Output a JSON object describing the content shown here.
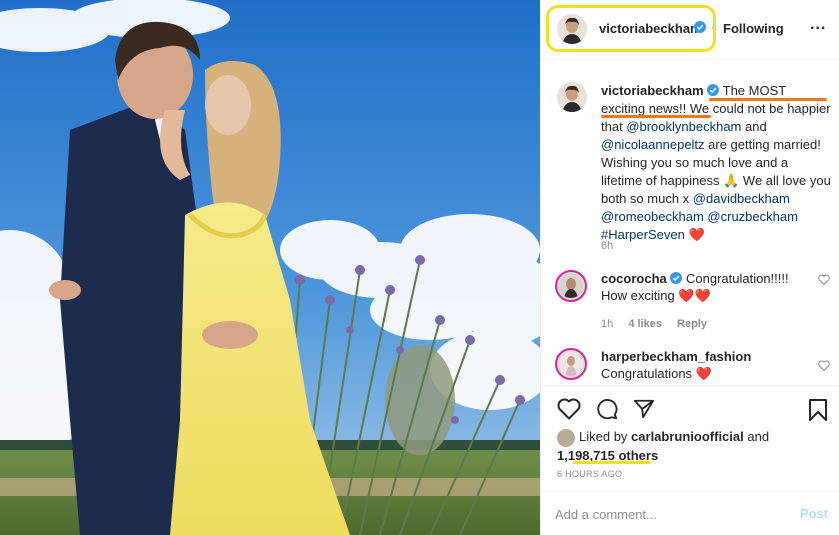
{
  "post": {
    "author": "victoriabeckham",
    "follow_separator": "•",
    "follow_status": "Following",
    "more_label": "...",
    "caption": {
      "author": "victoriabeckham",
      "part1": "The MOST exciting news!! We could not be happier that ",
      "mention1": "@brooklynbeckham",
      "part2": " and ",
      "mention2": "@nicolaannepeltz",
      "part3": " are getting married! Wishing you so much love and a lifetime of happiness 🙏 We all love you both so much x ",
      "mention3": "@davidbeckham",
      "mention4": "@romeobeckham",
      "mention5": "@cruzbeckham",
      "hashtag": "#HarperSeven",
      "emoji_end": "❤️",
      "time": "6h"
    },
    "comments": [
      {
        "user": "cocorocha",
        "text": "Congratulation!!!!! How exciting",
        "emoji": "❤️❤️",
        "time": "1h",
        "likes": "4 likes",
        "reply": "Reply"
      },
      {
        "user": "harperbeckham_fashion",
        "text": "Congratulations",
        "emoji": "❤️"
      }
    ],
    "likes": {
      "prefix": "Liked by",
      "user": "carlabrunio fficial",
      "user_display": "carlabrunioofficial",
      "and": "and",
      "count": "1,198,715 others"
    },
    "timestamp": "6 HOURS AGO",
    "add_comment_placeholder": "Add a comment...",
    "post_button": "Post"
  },
  "icons": {
    "verified": "verified-badge-icon",
    "heart": "heart-icon",
    "comment": "comment-icon",
    "share": "share-icon",
    "bookmark": "bookmark-icon"
  },
  "colors": {
    "verified_blue": "#3897f0",
    "link_blue": "#00376b",
    "annotation_yellow": "#f4e01c",
    "annotation_orange": "#f0781c",
    "post_button": "#b2dffc"
  }
}
